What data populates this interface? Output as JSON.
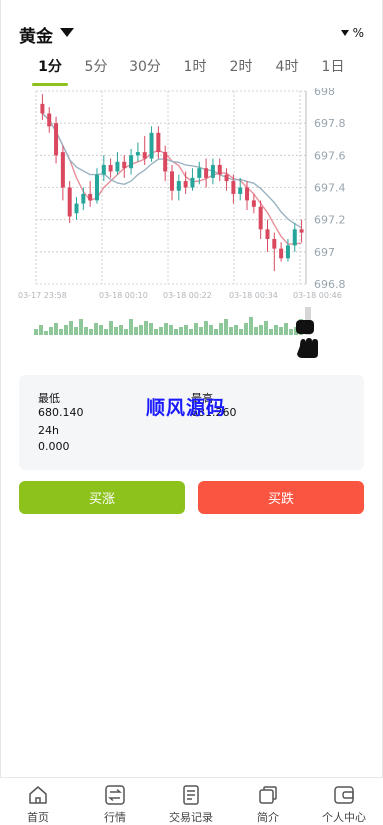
{
  "header": {
    "title": "黄金",
    "percent_label": "%"
  },
  "tabs": [
    {
      "label": "1分",
      "active": true
    },
    {
      "label": "5分"
    },
    {
      "label": "30分"
    },
    {
      "label": "1时"
    },
    {
      "label": "2时"
    },
    {
      "label": "4时"
    },
    {
      "label": "1日"
    }
  ],
  "chart": {
    "y_ticks": [
      "698",
      "697.8",
      "697.6",
      "697.4",
      "697.2",
      "697",
      "696.8"
    ],
    "x_ticks": [
      "03-17 23:58",
      "03-18 00:10",
      "03-18 00:22",
      "03-18 00:34",
      "03-18 00:46"
    ],
    "colors": {
      "up": "#26a69a",
      "down": "#d9485f",
      "ma1": "#e88f9b",
      "ma2": "#9bb3c1",
      "volume": "#8dc79a"
    }
  },
  "stats": {
    "low_label": "最低",
    "low_value": "680.140",
    "vol_label": "24h",
    "vol_value": "0.000",
    "high_label": "最高",
    "high_value": "681.260"
  },
  "watermark": "顺风源码",
  "actions": {
    "buy_label": "买涨",
    "sell_label": "买跌"
  },
  "nav": [
    {
      "label": "首页",
      "icon": "home-icon"
    },
    {
      "label": "行情",
      "icon": "exchange-icon"
    },
    {
      "label": "交易记录",
      "icon": "document-icon"
    },
    {
      "label": "简介",
      "icon": "copy-icon"
    },
    {
      "label": "个人中心",
      "icon": "wallet-icon"
    }
  ]
}
